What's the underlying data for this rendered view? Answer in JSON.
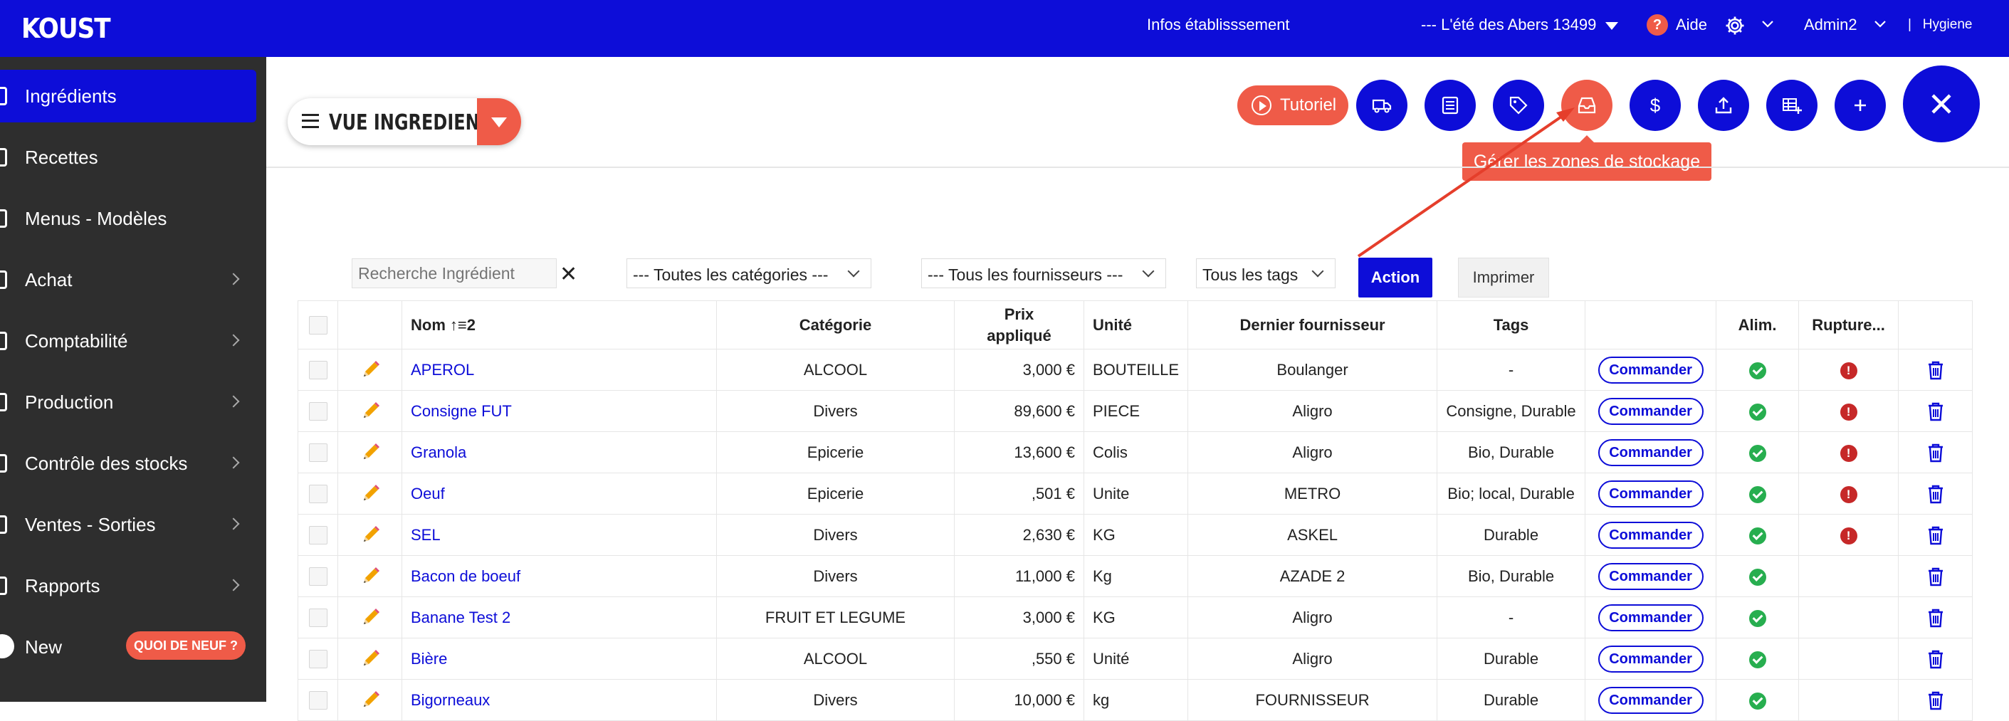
{
  "topbar": {
    "logo": "KOUST",
    "infos": "Infos établisssement",
    "establishment": "--- L'été des Abers 13499",
    "help": "Aide",
    "user": "Admin2",
    "hygiene": "|   Hygiene"
  },
  "sidebar": {
    "items": [
      {
        "label": "Ingrédients",
        "active": true
      },
      {
        "label": "Recettes"
      },
      {
        "label": "Menus - Modèles"
      },
      {
        "label": "Achat"
      },
      {
        "label": "Comptabilité"
      },
      {
        "label": "Production"
      },
      {
        "label": "Contrôle des stocks"
      },
      {
        "label": "Ventes - Sorties"
      },
      {
        "label": "Rapports"
      },
      {
        "label": "New"
      }
    ],
    "new_badge": "QUOI DE NEUF ?"
  },
  "toolbar": {
    "view_label": "VUE INGREDIENTS",
    "tutorial": "Tutoriel",
    "tooltip": "Gérer les zones de stockage"
  },
  "filters": {
    "search_placeholder": "Recherche Ingrédient",
    "categories": "--- Toutes les catégories ---",
    "suppliers": "--- Tous les fournisseurs ---",
    "tags": "Tous les tags",
    "action": "Action",
    "print": "Imprimer"
  },
  "table": {
    "headers": {
      "name": "Nom",
      "sort_badge": "2",
      "category": "Catégorie",
      "price_1": "Prix",
      "price_2": "appliqué",
      "unit": "Unité",
      "supplier": "Dernier fournisseur",
      "tags": "Tags",
      "alim": "Alim.",
      "rupture": "Rupture..."
    },
    "command_label": "Commander",
    "rows": [
      {
        "name": "APEROL",
        "category": "ALCOOL",
        "price": "3,000 €",
        "unit": "BOUTEILLE",
        "supplier": "Boulanger",
        "tags": "-",
        "alert": true
      },
      {
        "name": "Consigne FUT",
        "category": "Divers",
        "price": "89,600 €",
        "unit": "PIECE",
        "supplier": "Aligro",
        "tags": "Consigne, Durable",
        "alert": true
      },
      {
        "name": "Granola",
        "category": "Epicerie",
        "price": "13,600 €",
        "unit": "Colis",
        "supplier": "Aligro",
        "tags": "Bio, Durable",
        "alert": true
      },
      {
        "name": "Oeuf",
        "category": "Epicerie",
        "price": ",501 €",
        "unit": "Unite",
        "supplier": "METRO",
        "tags": "Bio; local, Durable",
        "alert": true
      },
      {
        "name": "SEL",
        "category": "Divers",
        "price": "2,630 €",
        "unit": "KG",
        "supplier": "ASKEL",
        "tags": "Durable",
        "alert": true
      },
      {
        "name": "Bacon de boeuf",
        "category": "Divers",
        "price": "11,000 €",
        "unit": "Kg",
        "supplier": "AZADE 2",
        "tags": "Bio, Durable",
        "alert": false
      },
      {
        "name": "Banane Test 2",
        "category": "FRUIT ET LEGUME",
        "price": "3,000 €",
        "unit": "KG",
        "supplier": "Aligro",
        "tags": "-",
        "alert": false
      },
      {
        "name": "Bière",
        "category": "ALCOOL",
        "price": ",550 €",
        "unit": "Unité",
        "supplier": "Aligro",
        "tags": "Durable",
        "alert": false
      },
      {
        "name": "Bigorneaux",
        "category": "Divers",
        "price": "10,000 €",
        "unit": "kg",
        "supplier": "FOURNISSEUR",
        "tags": "Durable",
        "alert": false
      }
    ]
  },
  "colors": {
    "primary": "#0d0dd8",
    "accent": "#ef5b48",
    "sidebar": "#2e2e2e"
  }
}
